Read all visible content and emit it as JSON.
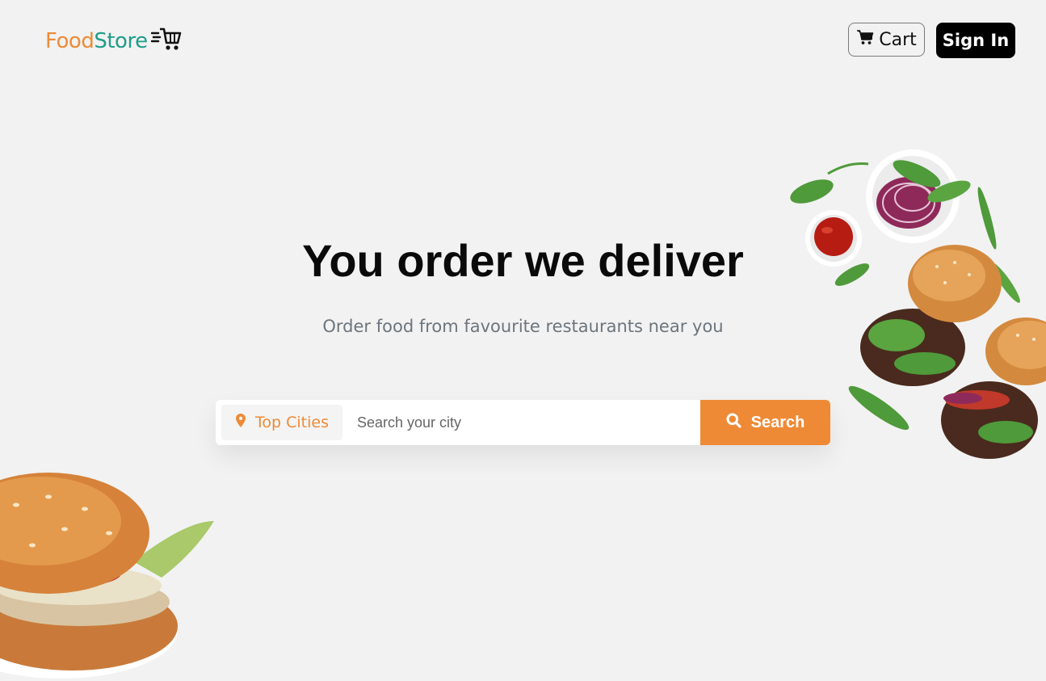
{
  "brand": {
    "name_part1": "Food",
    "name_part2": "Store",
    "logo_icon": "delivery-cart-icon",
    "colors": {
      "food": "#ee8a36",
      "store": "#1f9d8a"
    }
  },
  "header": {
    "cart_label": "Cart",
    "cart_icon": "shopping-cart-icon",
    "signin_label": "Sign In"
  },
  "hero": {
    "title": "You order we deliver",
    "subtitle": "Order food from favourite restaurants near you"
  },
  "search": {
    "location_icon": "map-marker-icon",
    "top_cities_label": "Top Cities",
    "placeholder": "Search your city",
    "value": "",
    "button_label": "Search",
    "button_icon": "search-icon"
  },
  "colors": {
    "accent": "#ee8a36",
    "background": "#f2f2f2",
    "signin_bg": "#000000"
  }
}
